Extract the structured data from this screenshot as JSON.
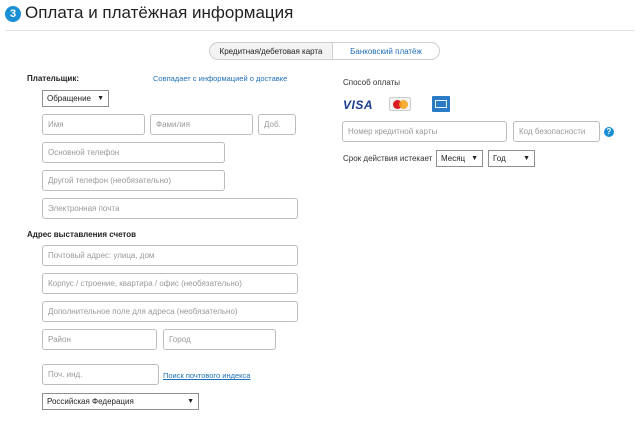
{
  "header": {
    "step_number": "3",
    "title": "Оплата и платёжная информация"
  },
  "tabs": [
    {
      "label": "Кредитная/дебетовая карта",
      "active": true
    },
    {
      "label": "Банковский платёж",
      "active": false
    }
  ],
  "payer": {
    "label": "Плательщик:",
    "same_as_shipping_link": "Совпадает с информацией о доставке",
    "salutation_select": "Обращение",
    "first_name_placeholder": "Имя",
    "last_name_placeholder": "Фамилия",
    "extension_placeholder": "Доб.",
    "main_phone_placeholder": "Основной телефон",
    "other_phone_placeholder": "Другой телефон (необязательно)",
    "email_placeholder": "Электронная почта"
  },
  "billing": {
    "label": "Адрес выставления счетов",
    "street_placeholder": "Почтовый адрес: улица, дом",
    "building_placeholder": "Корпус / строение, квартира / офис (необязательно)",
    "extra_placeholder": "Дополнительное поле для адреса (необязательно)",
    "district_placeholder": "Район",
    "city_placeholder": "Город",
    "postcode_placeholder": "Поч. инд.",
    "postcode_lookup_link": "Поиск почтового индекса",
    "country_select": "Российская Федерация"
  },
  "payment": {
    "method_label": "Способ оплаты",
    "card_logos": [
      "visa-logo",
      "mastercard-logo",
      "amex-logo"
    ],
    "visa_text": "VISA",
    "card_number_placeholder": "Номер кредитной карты",
    "security_code_placeholder": "Код безопасности",
    "help_icon": "?",
    "expiry_label": "Срок действия истекает",
    "month_select": "Месяц",
    "year_select": "Год"
  },
  "colors": {
    "accent": "#1a8fd6",
    "link": "#1e6fb8",
    "input_border": "#bdbdbd"
  }
}
